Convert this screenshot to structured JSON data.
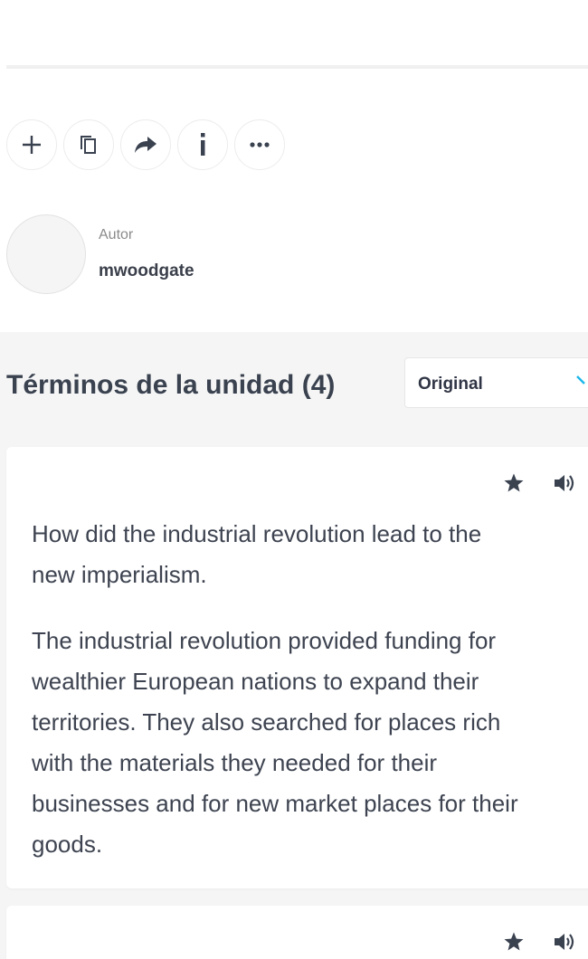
{
  "author": {
    "label": "Autor",
    "name": "mwoodgate"
  },
  "actions": [
    {
      "name": "add",
      "icon": "plus-icon"
    },
    {
      "name": "copy",
      "icon": "copy-icon"
    },
    {
      "name": "share",
      "icon": "share-arrow-icon"
    },
    {
      "name": "info",
      "icon": "info-icon"
    },
    {
      "name": "more",
      "icon": "ellipsis-icon"
    }
  ],
  "terms_section": {
    "title": "Términos de la unidad (4)",
    "language_select": {
      "value": "Original",
      "accent_color": "#1ab7ea"
    }
  },
  "cards": [
    {
      "term": "How did the industrial revolution lead to the new imperialism.",
      "definition": "The industrial revolution provided funding for wealthier European nations to expand their territories. They also searched for places rich with the materials they needed for their businesses and for new market places for their goods."
    },
    {
      "term": "",
      "definition": ""
    }
  ]
}
